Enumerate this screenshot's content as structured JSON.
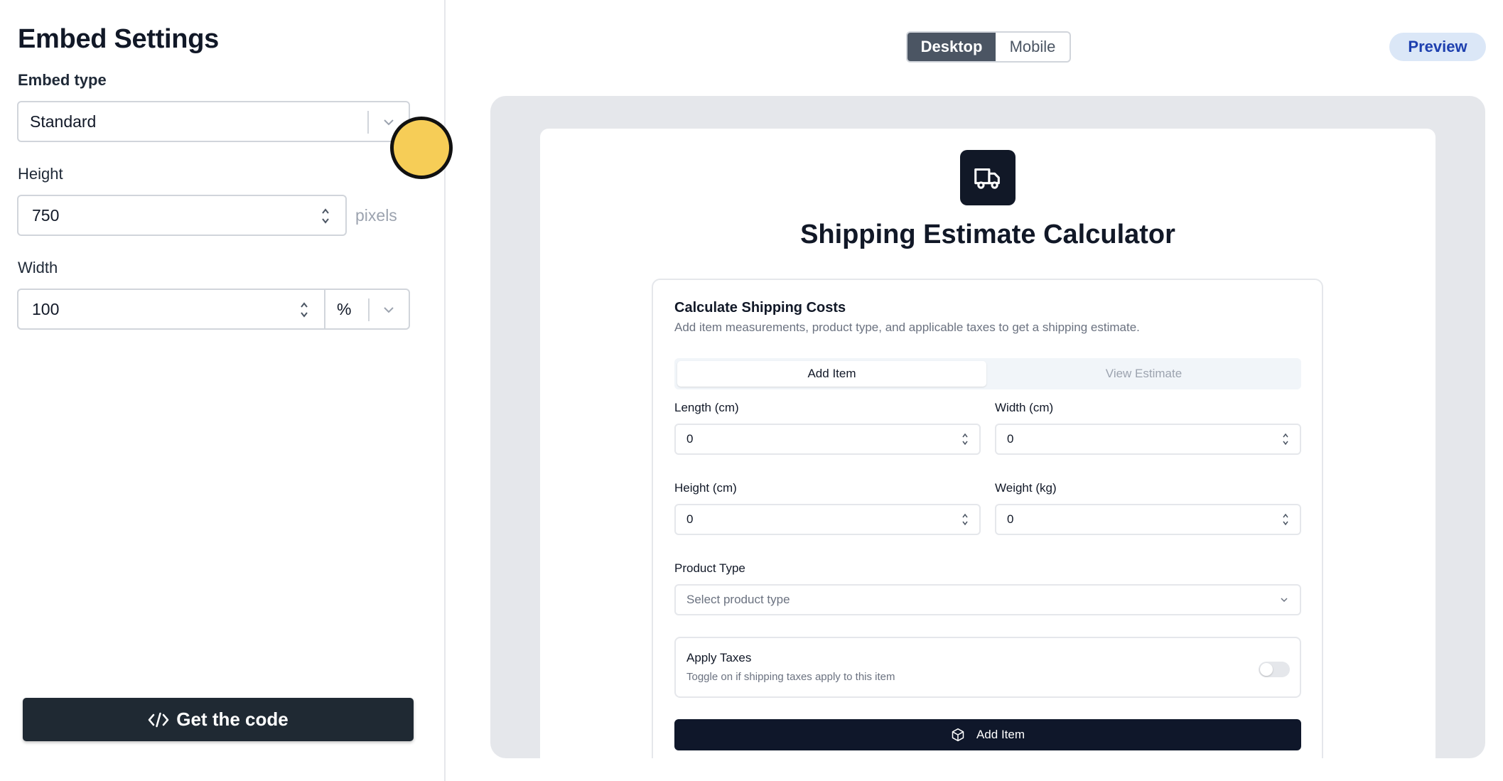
{
  "settings": {
    "title": "Embed Settings",
    "embed_type": {
      "label": "Embed type",
      "value": "Standard"
    },
    "height": {
      "label": "Height",
      "value": "750",
      "unit": "pixels"
    },
    "width": {
      "label": "Width",
      "value": "100",
      "unit": "%"
    },
    "get_code_label": "Get the code"
  },
  "toolbar": {
    "device_tabs": [
      "Desktop",
      "Mobile"
    ],
    "active_device": "Desktop",
    "preview_label": "Preview"
  },
  "app": {
    "title": "Shipping Estimate Calculator",
    "form": {
      "title": "Calculate Shipping Costs",
      "description": "Add item measurements, product type, and applicable taxes to get a shipping estimate.",
      "tabs": [
        "Add Item",
        "View Estimate"
      ],
      "length": {
        "label": "Length (cm)",
        "value": "0"
      },
      "width": {
        "label": "Width (cm)",
        "value": "0"
      },
      "height": {
        "label": "Height (cm)",
        "value": "0"
      },
      "weight": {
        "label": "Weight (kg)",
        "value": "0"
      },
      "product_type": {
        "label": "Product Type",
        "placeholder": "Select product type"
      },
      "taxes": {
        "title": "Apply Taxes",
        "description": "Toggle on if shipping taxes apply to this item",
        "enabled": false
      },
      "submit_label": "Add Item"
    }
  },
  "colors": {
    "cursor": "#f6cd57",
    "button_dark": "#1f2933",
    "active_tab": "#4b5563",
    "preview_pill": "#dbe7f7",
    "app_primary": "#0f172a"
  },
  "icons": [
    "chevron-down-icon",
    "stepper-icon",
    "code-icon",
    "truck-icon",
    "package-icon"
  ]
}
